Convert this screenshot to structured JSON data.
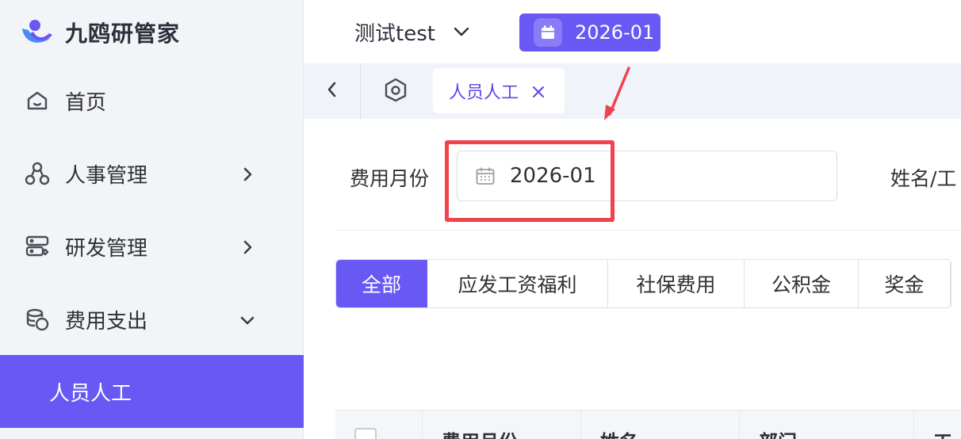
{
  "brand": {
    "name": "九鸥研管家",
    "accent": "#6a58f5"
  },
  "sidebar": {
    "items": [
      {
        "label": "首页",
        "icon": "home-icon"
      },
      {
        "label": "人事管理",
        "icon": "org-icon",
        "chevron": "chevron-right-icon"
      },
      {
        "label": "研发管理",
        "icon": "server-icon",
        "chevron": "chevron-right-icon"
      },
      {
        "label": "费用支出",
        "icon": "coins-icon",
        "chevron": "chevron-down-icon"
      }
    ],
    "active_sub": "人员人工"
  },
  "header": {
    "company": "测试test",
    "month": "2026-01"
  },
  "tabs": {
    "current": "人员人工"
  },
  "filters": {
    "month_label": "费用月份",
    "month_value": "2026-01",
    "name_label": "姓名/工"
  },
  "segments": [
    "全部",
    "应发工资福利",
    "社保费用",
    "公积金",
    "奖金"
  ],
  "table": {
    "headers": [
      "费用月份",
      "姓名",
      "部门",
      "工"
    ]
  },
  "annotation": {
    "highlight_color": "#f0434b"
  }
}
